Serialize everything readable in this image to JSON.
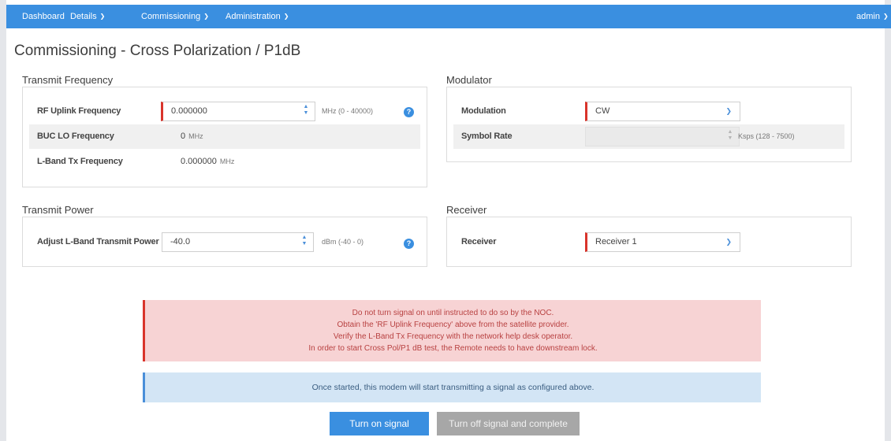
{
  "nav": {
    "dashboard": "Dashboard",
    "details": "Details",
    "commissioning": "Commissioning",
    "administration": "Administration",
    "user": "admin"
  },
  "page_title": "Commissioning - Cross Polarization / P1dB",
  "transmit_frequency": {
    "title": "Transmit Frequency",
    "rf_uplink": {
      "label": "RF Uplink Frequency",
      "value": "0.000000",
      "unit": "MHz (0 - 40000)"
    },
    "buc_lo": {
      "label": "BUC LO Frequency",
      "value": "0",
      "unit": "MHz"
    },
    "lband_tx": {
      "label": "L-Band Tx Frequency",
      "value": "0.000000",
      "unit": "MHz"
    }
  },
  "modulator": {
    "title": "Modulator",
    "modulation": {
      "label": "Modulation",
      "value": "CW"
    },
    "symbol_rate": {
      "label": "Symbol Rate",
      "value": "",
      "unit": "Ksps (128 - 7500)"
    }
  },
  "transmit_power": {
    "title": "Transmit Power",
    "adjust": {
      "label": "Adjust L-Band Transmit Power",
      "value": "-40.0",
      "unit": "dBm (-40 - 0)"
    }
  },
  "receiver": {
    "title": "Receiver",
    "receiver": {
      "label": "Receiver",
      "value": "Receiver 1"
    }
  },
  "warning": {
    "line1": "Do not turn signal on until instructed to do so by the NOC.",
    "line2": "Obtain the 'RF Uplink Frequency' above from the satellite provider.",
    "line3": "Verify the L-Band Tx Frequency with the network help desk operator.",
    "line4": "In order to start Cross Pol/P1 dB test, the Remote needs to have downstream lock."
  },
  "info": "Once started, this modem will start transmitting a signal as configured above.",
  "buttons": {
    "turn_on": "Turn on signal",
    "turn_off": "Turn off signal and complete"
  },
  "colors": {
    "nav_bg": "#3a8fe0",
    "required_marker": "#d9342b",
    "warning_bg": "#f7d3d4",
    "info_bg": "#d3e5f5",
    "primary_button": "#3a8fe0",
    "disabled_button": "#a7a7a7"
  },
  "icons": {
    "help": "help-icon",
    "dropdown": "chevron-down-icon",
    "spinner": "spinner-arrows-icon"
  }
}
